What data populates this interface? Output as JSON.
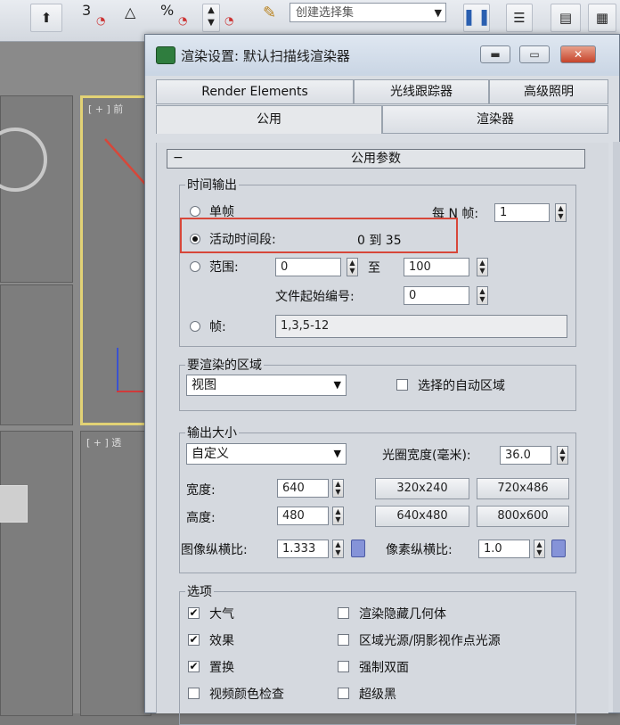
{
  "toolbar": {
    "num3": "3",
    "percent": "%",
    "selection_set": "创建选择集"
  },
  "dialog": {
    "title": "渲染设置: 默认扫描线渲染器",
    "minimize": "▬",
    "restore": "▭",
    "close": "✕",
    "tabs_top": [
      "Render Elements",
      "光线跟踪器",
      "高级照明"
    ],
    "tabs_bottom": [
      "公用",
      "渲染器"
    ]
  },
  "rollout": {
    "toggle": "−",
    "title": "公用参数"
  },
  "time_output": {
    "group": "时间输出",
    "single": "单帧",
    "every_n_label": "每 N 帧:",
    "every_n_value": "1",
    "active_segment": "活动时间段:",
    "active_segment_value": "0 到 35",
    "range": "范围:",
    "range_from": "0",
    "range_to_label": "至",
    "range_to": "100",
    "file_start_label": "文件起始编号:",
    "file_start": "0",
    "frames": "帧:",
    "frames_value": "1,3,5-12",
    "selected": "active_segment"
  },
  "render_area": {
    "group": "要渲染的区域",
    "area": "视图",
    "auto_region": "选择的自动区域"
  },
  "output_size": {
    "group": "输出大小",
    "preset": "自定义",
    "aperture_label": "光圈宽度(毫米):",
    "aperture": "36.0",
    "width_label": "宽度:",
    "width": "640",
    "height_label": "高度:",
    "height": "480",
    "presets": [
      "320x240",
      "720x486",
      "640x480",
      "800x600"
    ],
    "image_aspect_label": "图像纵横比:",
    "image_aspect": "1.333",
    "pixel_aspect_label": "像素纵横比:",
    "pixel_aspect": "1.0"
  },
  "options": {
    "group": "选项",
    "items_left": [
      {
        "label": "大气",
        "checked": true
      },
      {
        "label": "效果",
        "checked": true
      },
      {
        "label": "置换",
        "checked": true
      },
      {
        "label": "视频颜色检查",
        "checked": false
      }
    ],
    "items_right": [
      {
        "label": "渲染隐藏几何体",
        "checked": false
      },
      {
        "label": "区域光源/阴影视作点光源",
        "checked": false
      },
      {
        "label": "强制双面",
        "checked": false
      },
      {
        "label": "超级黑",
        "checked": false
      }
    ],
    "check_mark": "✔"
  },
  "viewport": {
    "label_a": "[ + ] 前",
    "label_b": "[ + ] 透"
  },
  "annotation_color": "#d7473a"
}
